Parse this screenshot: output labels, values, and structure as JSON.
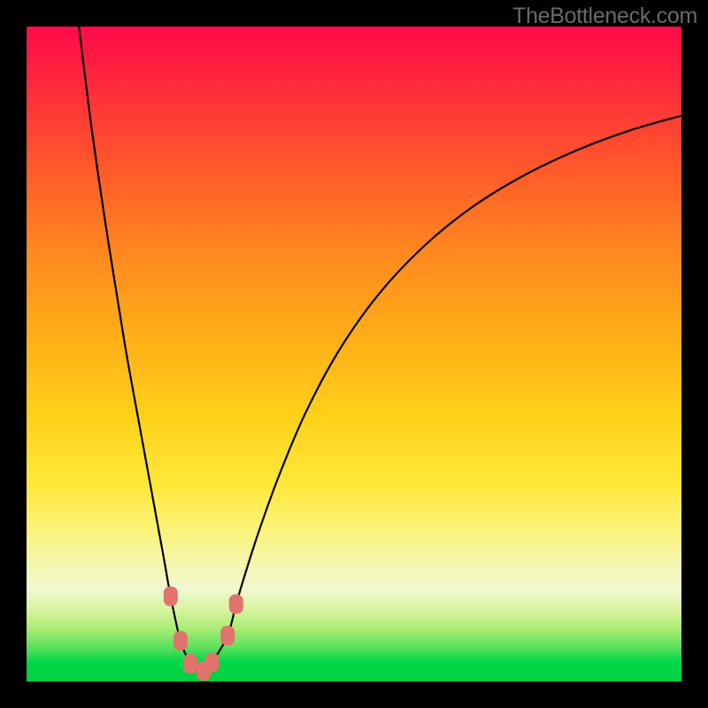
{
  "attribution": "TheBottleneck.com",
  "colors": {
    "background": "#000000",
    "curve_stroke": "#000000",
    "marker_fill": "#e2736c",
    "marker_stroke": "#e2736c",
    "gradient_stops": [
      "#ff0a4a",
      "#ff2e3a",
      "#ff5a2a",
      "#ff8a1f",
      "#ffb018",
      "#ffd21a",
      "#ffe83a",
      "#fbf37a",
      "#f4f6b4",
      "#f0f8d0",
      "#d8f3a0",
      "#a8ec74",
      "#55e05a",
      "#00d848",
      "#00d040"
    ]
  },
  "chart_data": {
    "type": "line",
    "title": "",
    "xlabel": "",
    "ylabel": "",
    "xlim": [
      0,
      100
    ],
    "ylim": [
      0,
      100
    ],
    "grid": false,
    "legend": false,
    "series": [
      {
        "name": "bottleneck-curve",
        "x": [
          8.0,
          10.0,
          12.5,
          15.0,
          17.5,
          19.5,
          21.0,
          22.0,
          23.5,
          25.0,
          26.0,
          27.0,
          28.3,
          30.7,
          32.0,
          33.5,
          35.5,
          38.5,
          42.5,
          47.5,
          53.5,
          60.5,
          68.0,
          76.0,
          84.0,
          92.0,
          100.0
        ],
        "y": [
          100.0,
          84.0,
          67.0,
          51.5,
          37.7,
          26.8,
          18.6,
          13.0,
          6.2,
          2.7,
          1.6,
          1.6,
          2.9,
          7.0,
          11.8,
          16.8,
          23.0,
          31.3,
          40.8,
          50.2,
          58.8,
          66.3,
          72.4,
          77.3,
          81.1,
          84.1,
          86.4
        ]
      }
    ],
    "markers": [
      {
        "x": 22.0,
        "y": 13.0
      },
      {
        "x": 23.5,
        "y": 6.2
      },
      {
        "x": 25.0,
        "y": 2.7
      },
      {
        "x": 27.0,
        "y": 1.6
      },
      {
        "x": 28.3,
        "y": 2.9
      },
      {
        "x": 30.7,
        "y": 7.0
      },
      {
        "x": 32.0,
        "y": 11.8
      }
    ]
  }
}
